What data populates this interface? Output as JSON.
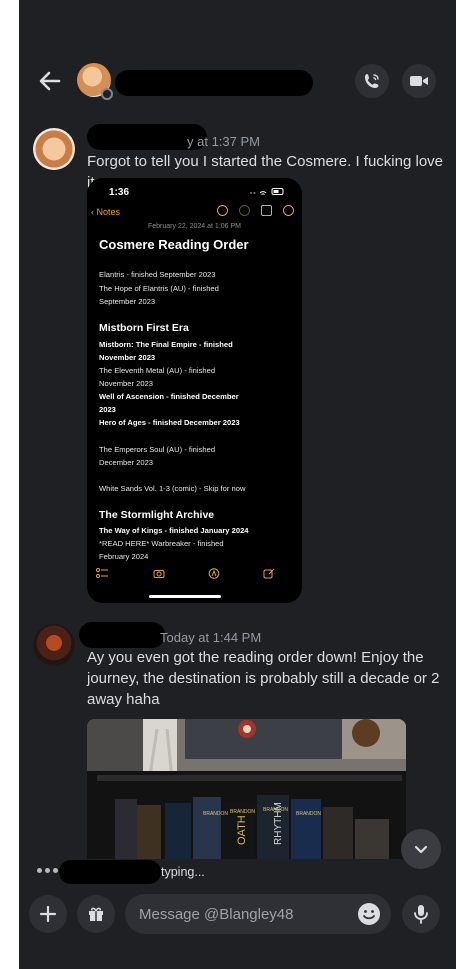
{
  "header": {
    "back_icon": "arrow-left-icon",
    "call_icon": "phone-call-icon",
    "video_icon": "video-camera-icon"
  },
  "messages": [
    {
      "timestamp": "y at 1:37 PM",
      "text": "Forgot to tell you I started the Cosmere. I fucking love it.",
      "attachment": {
        "status_time": "1:36",
        "back_label": "Notes",
        "date": "February 22, 2024 at 1:06 PM",
        "title": "Cosmere Reading Order",
        "lines": [
          "Elantris - finished September 2023",
          "The Hope of Elantris (AU) - finished",
          "September 2023"
        ],
        "section1": "Mistborn First Era",
        "section1_lines": [
          "Mistborn: The Final Empire - finished",
          "November 2023",
          "The Eleventh Metal (AU) - finished",
          "November 2023",
          "Well of Ascension - finished December",
          "2023",
          "Hero of Ages - finished December 2023"
        ],
        "lines2": [
          "The Emperors Soul (AU) - finished",
          "December 2023"
        ],
        "line3": "White Sands Vol. 1-3 (comic) - Skip for now",
        "section2": "The Stormlight Archive",
        "section2_lines": [
          "The Way of Kings - finished January 2024",
          "*READ HERE* Warbreaker - finished",
          "February 2024"
        ]
      }
    },
    {
      "timestamp": "Today at 1:44 PM",
      "text_lines": [
        "Ay you even got the reading order down! Enjoy the",
        "journey, the destination is probably still a decade or 2",
        "away haha"
      ],
      "photo_book_labels": [
        "BRANDON SANDERSON",
        "BRANDON SANDERSON",
        "BRANDON SANDERSON",
        "OATH",
        "RHYTHM"
      ]
    }
  ],
  "typing_text": "typing...",
  "input": {
    "placeholder": "Message @Blangley48"
  },
  "colors": {
    "background": "#1f2024",
    "notes_accent": "#e8a33c",
    "text": "#dbdee1",
    "muted": "#949ba4"
  }
}
